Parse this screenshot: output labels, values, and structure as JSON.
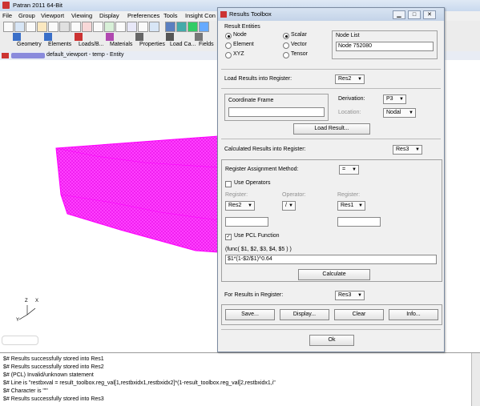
{
  "app": {
    "title": "Patran 2011 64-Bit"
  },
  "menu": [
    "File",
    "Group",
    "Viewport",
    "Viewing",
    "Display",
    "Preferences",
    "Tools",
    "Insight Con"
  ],
  "appbar": [
    "Geometry",
    "Elements",
    "Loads/B...",
    "Materials",
    "Properties",
    "Load Ca...",
    "Fields"
  ],
  "viewport": {
    "title": "default_viewport - temp - Entity",
    "axis": {
      "x": "X",
      "y": "Y",
      "z": "Z"
    },
    "mesh_color": "#ff00ff"
  },
  "console": [
    "$# Results successfully stored into Res1",
    "$# Results successfully stored into Res2",
    "$# (PCL) Invalid/unknown statement",
    "$# Line is \"restbxval = result_toolbox.reg_val[1,restbxidx1,restbxidx2]*(1-result_toolbox.reg_val[2,restbxidx1,i\"",
    "$# Character is \"'\"",
    "$# Results successfully stored into Res3"
  ],
  "dialog": {
    "title": "Results Toolbox",
    "result_entities": {
      "label": "Result Entities",
      "options": [
        "Node",
        "Element",
        "XYZ"
      ],
      "selected": "Node",
      "types": [
        "Scalar",
        "Vector",
        "Tensor"
      ],
      "selected_type": "Scalar"
    },
    "node_list": {
      "label": "Node List",
      "value": "Node 752080"
    },
    "load_register": {
      "label": "Load Results into Register:",
      "value": "Res2"
    },
    "coord_frame": {
      "label": "Coordinate Frame",
      "value": ""
    },
    "derivation": {
      "label": "Derivation:",
      "value": "P3"
    },
    "location": {
      "label": "Location:",
      "value": "Nodal"
    },
    "load_result_button": "Load Result...",
    "calc_register": {
      "label": "Calculated Results into Register:",
      "value": "Res3"
    },
    "assign": {
      "label": "Register Assignment Method:",
      "value": "="
    },
    "use_operators": {
      "label": "Use Operators",
      "checked": false
    },
    "operands": {
      "register_label": "Register:",
      "operator_label": "Operator:",
      "left": "Res2",
      "operator": "/",
      "right": "Res1"
    },
    "use_pcl": {
      "label": "Use PCL Function",
      "checked": true
    },
    "func_signature": "(func( $1, $2, $3, $4, $5 ) )",
    "func_value": "$1*(1-$2/$1)^0.64",
    "calculate_button": "Calculate",
    "for_results": {
      "label": "For Results in Register:",
      "value": "Res3"
    },
    "actions": [
      "Save...",
      "Display...",
      "Clear",
      "Info..."
    ],
    "ok": "Ok"
  }
}
